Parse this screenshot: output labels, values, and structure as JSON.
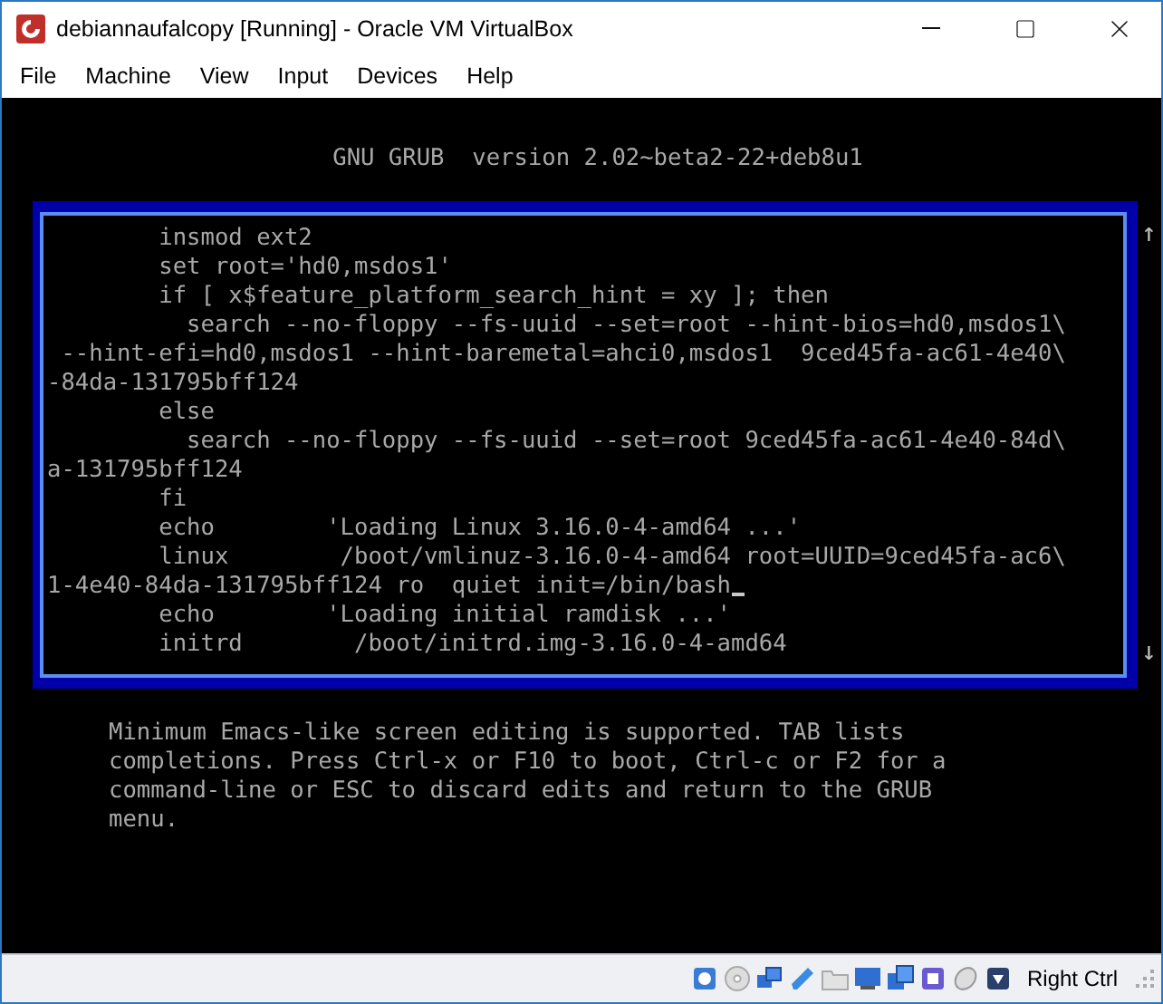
{
  "window": {
    "title": "debiannaufalcopy [Running] - Oracle VM VirtualBox"
  },
  "menu": [
    "File",
    "Machine",
    "View",
    "Input",
    "Devices",
    "Help"
  ],
  "grub": {
    "header": "GNU GRUB  version 2.02~beta2-22+deb8u1",
    "lines": [
      "        insmod ext2",
      "        set root='hd0,msdos1'",
      "        if [ x$feature_platform_search_hint = xy ]; then",
      "          search --no-floppy --fs-uuid --set=root --hint-bios=hd0,msdos1\\",
      " --hint-efi=hd0,msdos1 --hint-baremetal=ahci0,msdos1  9ced45fa-ac61-4e40\\",
      "-84da-131795bff124",
      "        else",
      "          search --no-floppy --fs-uuid --set=root 9ced45fa-ac61-4e40-84d\\",
      "a-131795bff124",
      "        fi",
      "        echo        'Loading Linux 3.16.0-4-amd64 ...'",
      "        linux        /boot/vmlinuz-3.16.0-4-amd64 root=UUID=9ced45fa-ac6\\",
      {
        "text": "1-4e40-84da-131795bff124 ro  quiet init=/bin/bash",
        "cursor": true
      },
      "        echo        'Loading initial ramdisk ...'",
      "        initrd        /boot/initrd.img-3.16.0-4-amd64"
    ],
    "scroll_up": "↑",
    "scroll_down": "↓",
    "help": [
      "Minimum Emacs-like screen editing is supported. TAB lists",
      "completions. Press Ctrl-x or F10 to boot, Ctrl-c or F2 for a",
      "command-line or ESC to discard edits and return to the GRUB",
      "menu."
    ]
  },
  "status_bar": {
    "host_key": "Right Ctrl"
  }
}
